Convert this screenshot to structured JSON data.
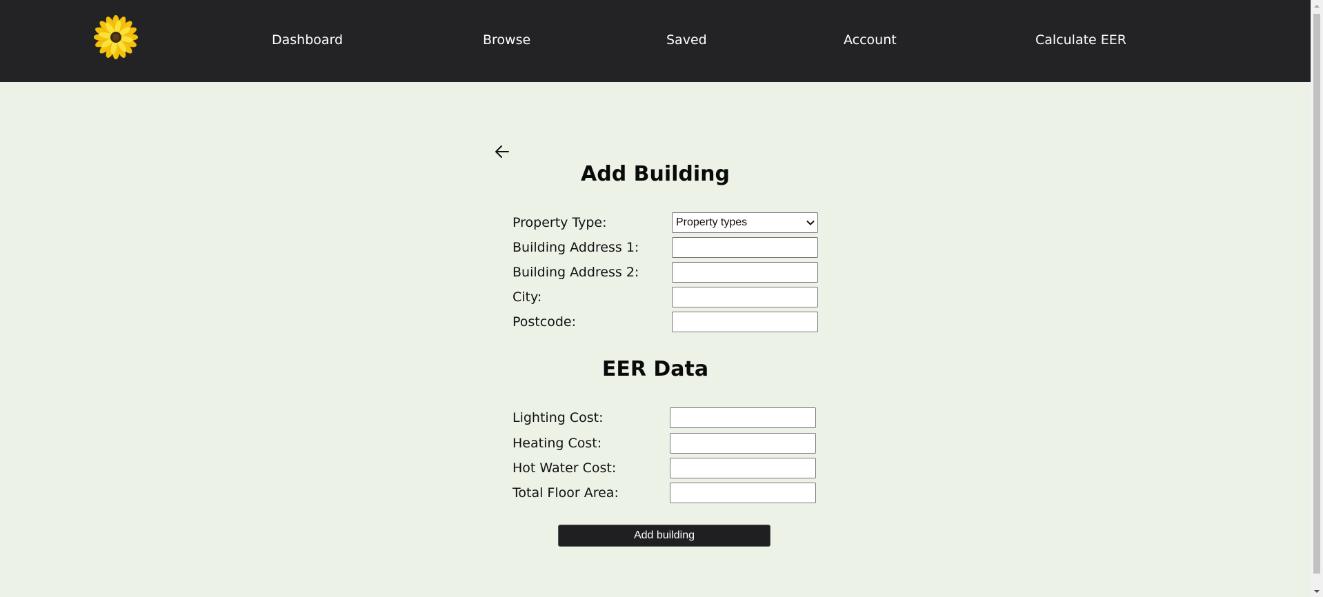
{
  "nav": {
    "logo": "sunflower",
    "items": [
      {
        "label": "Dashboard"
      },
      {
        "label": "Browse"
      },
      {
        "label": "Saved"
      },
      {
        "label": "Account"
      },
      {
        "label": "Calculate EER"
      }
    ]
  },
  "form": {
    "back_icon": "arrow-left-icon",
    "title": "Add Building",
    "fields": {
      "property_type": {
        "label": "Property Type:",
        "value": "Property types"
      },
      "address1": {
        "label": "Building Address 1:",
        "value": ""
      },
      "address2": {
        "label": "Building Address 2:",
        "value": ""
      },
      "city": {
        "label": "City:",
        "value": ""
      },
      "postcode": {
        "label": "Postcode:",
        "value": ""
      }
    },
    "eer_title": "EER Data",
    "eer_fields": {
      "lighting_cost": {
        "label": "Lighting Cost:",
        "value": ""
      },
      "heating_cost": {
        "label": "Heating Cost:",
        "value": ""
      },
      "hot_water_cost": {
        "label": "Hot Water Cost:",
        "value": ""
      },
      "total_floor_area": {
        "label": "Total Floor Area:",
        "value": ""
      }
    },
    "submit_label": "Add building"
  },
  "colors": {
    "header_bg": "#232325",
    "page_bg": "#edf2e7",
    "button_bg": "#1f1f21",
    "logo_petals": "#f7d917",
    "logo_center": "#3b2a12"
  }
}
